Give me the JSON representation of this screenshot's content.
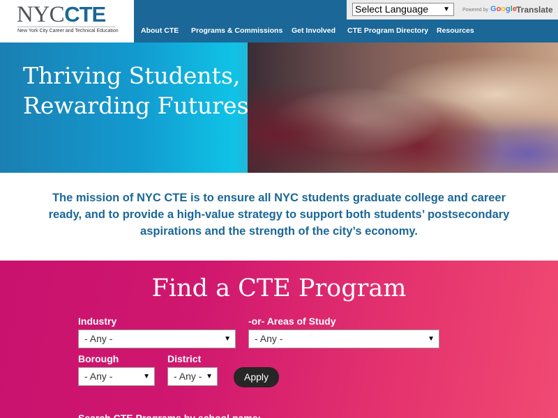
{
  "logo": {
    "main": "NYC",
    "accent": "CTE",
    "subtitle": "New York City Career and Technical Education"
  },
  "translate": {
    "language_select": "Select Language",
    "powered_by": "Powered by",
    "google": [
      "G",
      "o",
      "o",
      "g",
      "l",
      "e"
    ],
    "translate_label": "Translate"
  },
  "nav": {
    "items": [
      {
        "label": "About CTE"
      },
      {
        "label": "Programs & Commissions"
      },
      {
        "label": "Get Involved"
      },
      {
        "label": "CTE Program Directory"
      },
      {
        "label": "Resources"
      }
    ]
  },
  "hero": {
    "line1": "Thriving Students,",
    "line2": "Rewarding Futures"
  },
  "mission": {
    "text": "The mission of NYC CTE is to ensure all NYC students graduate college and career ready, and to provide a high-value strategy to support both students’ postsecondary aspirations and the strength of the city’s economy."
  },
  "find": {
    "title": "Find a CTE Program",
    "industry_label": "Industry",
    "industry_value": "- Any -",
    "areas_label": "-or- Areas of Study",
    "areas_value": "- Any -",
    "borough_label": "Borough",
    "borough_value": "- Any -",
    "district_label": "District",
    "district_value": "- Any -",
    "apply_label": "Apply",
    "search_label": "Search CTE Programs by school name:"
  },
  "colors": {
    "brand_blue": "#1b6797",
    "find_pink": "#d0176f",
    "apply_dark": "#262626"
  }
}
